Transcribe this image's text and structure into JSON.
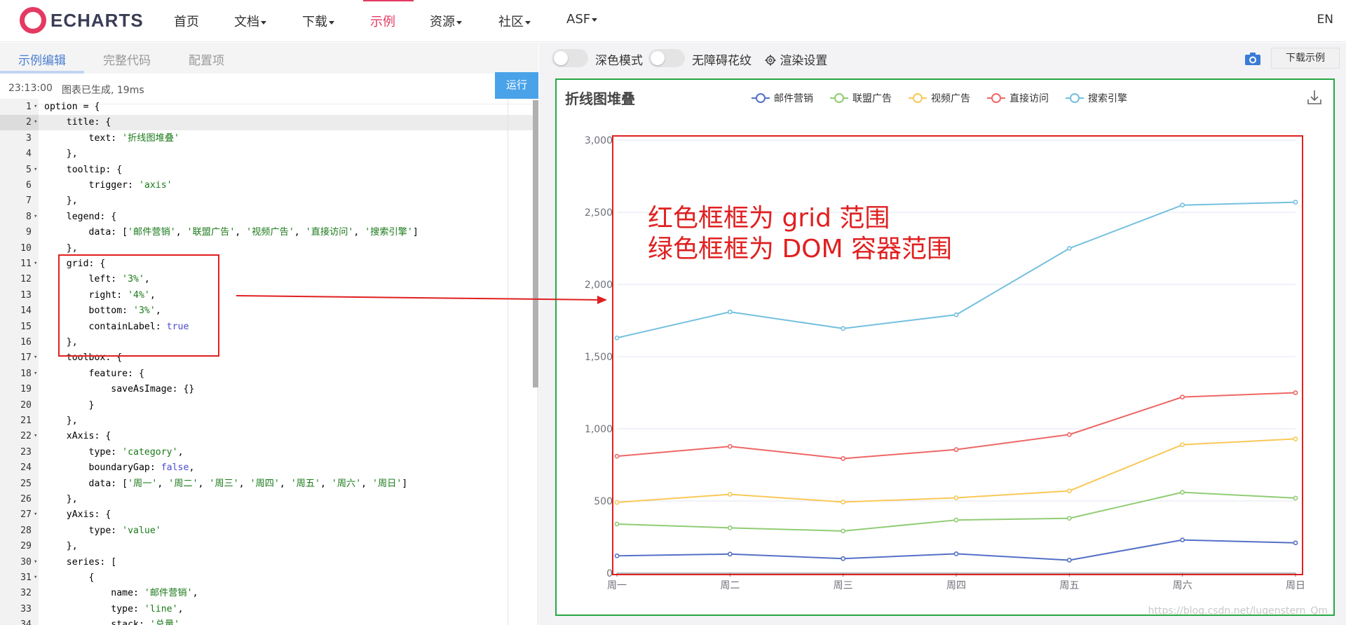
{
  "nav": {
    "logo_text": "ECHARTS",
    "items": [
      {
        "label": "首页",
        "dropdown": false,
        "active": false
      },
      {
        "label": "文档",
        "dropdown": true,
        "active": false
      },
      {
        "label": "下载",
        "dropdown": true,
        "active": false
      },
      {
        "label": "示例",
        "dropdown": false,
        "active": true
      },
      {
        "label": "资源",
        "dropdown": true,
        "active": false
      },
      {
        "label": "社区",
        "dropdown": true,
        "active": false
      },
      {
        "label": "ASF",
        "dropdown": true,
        "active": false
      }
    ],
    "lang": "EN",
    "accent_color": "#e43961"
  },
  "editor_panel": {
    "tabs": [
      "示例编辑",
      "完整代码",
      "配置项"
    ],
    "status_time": "23:13:00",
    "status_msg": "图表已生成, 19ms",
    "run_label": "运行",
    "code_lines": [
      "option = {",
      "    title: {",
      "        text: '折线图堆叠'",
      "    },",
      "    tooltip: {",
      "        trigger: 'axis'",
      "    },",
      "    legend: {",
      "        data: ['邮件营销', '联盟广告', '视频广告', '直接访问', '搜索引擎']",
      "    },",
      "    grid: {",
      "        left: '3%',",
      "        right: '4%',",
      "        bottom: '3%',",
      "        containLabel: true",
      "    },",
      "    toolbox: {",
      "        feature: {",
      "            saveAsImage: {}",
      "        }",
      "    },",
      "    xAxis: {",
      "        type: 'category',",
      "        boundaryGap: false,",
      "        data: ['周一', '周二', '周三', '周四', '周五', '周六', '周日']",
      "    },",
      "    yAxis: {",
      "        type: 'value'",
      "    },",
      "    series: [",
      "        {",
      "            name: '邮件营销',",
      "            type: 'line',",
      "            stack: '总量',"
    ],
    "fold_lines": [
      1,
      2,
      5,
      8,
      11,
      17,
      18,
      22,
      27,
      30,
      31
    ]
  },
  "preview": {
    "dark_mode_label": "深色模式",
    "decal_label": "无障碍花纹",
    "render_settings_label": "渲染设置",
    "download_example_label": "下载示例",
    "camera_icon": "camera-icon"
  },
  "annotations": {
    "line1": "红色框框为 grid 范围",
    "line2": "绿色框框为 DOM 容器范围",
    "red_color": "#e02020",
    "green_color": "#27a844"
  },
  "watermark": "https://blog.csdn.net/lugenstern_Qm",
  "chart_data": {
    "type": "line",
    "title": "折线图堆叠",
    "categories": [
      "周一",
      "周二",
      "周三",
      "周四",
      "周五",
      "周六",
      "周日"
    ],
    "ylim": [
      0,
      3000
    ],
    "yticks": [
      "0",
      "500",
      "1,000",
      "1,500",
      "2,000",
      "2,500",
      "3,000"
    ],
    "stacked": true,
    "grid": true,
    "legend_position": "top-center",
    "series": [
      {
        "name": "邮件营销",
        "color": "#5470c6",
        "values": [
          120,
          132,
          101,
          134,
          90,
          230,
          210
        ]
      },
      {
        "name": "联盟广告",
        "color": "#91cc75",
        "values": [
          220,
          182,
          191,
          234,
          290,
          330,
          310
        ]
      },
      {
        "name": "视频广告",
        "color": "#fac858",
        "values": [
          150,
          232,
          201,
          154,
          190,
          330,
          410
        ]
      },
      {
        "name": "直接访问",
        "color": "#ee6666",
        "values": [
          320,
          332,
          301,
          334,
          390,
          330,
          320
        ]
      },
      {
        "name": "搜索引擎",
        "color": "#73c0de",
        "values": [
          820,
          932,
          901,
          934,
          1290,
          1330,
          1320
        ]
      }
    ]
  }
}
